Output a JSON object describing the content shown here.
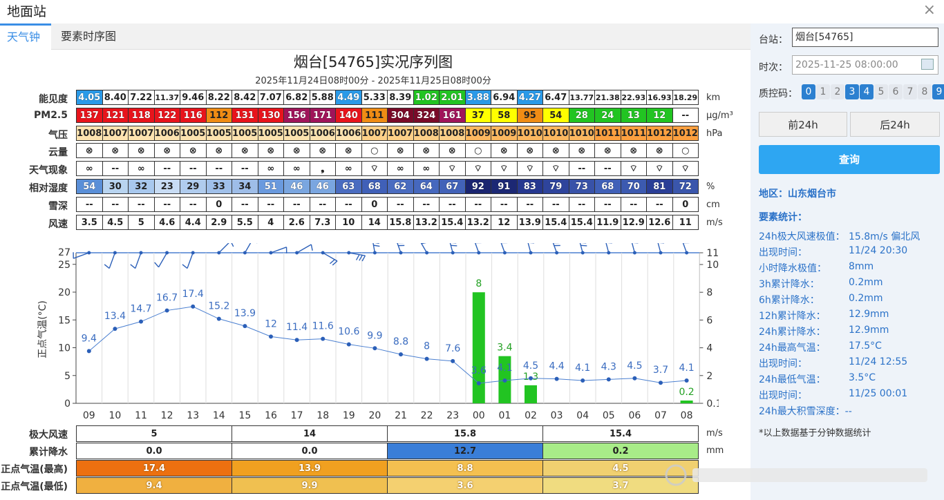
{
  "window": {
    "title": "地面站",
    "close": "×"
  },
  "tabs": [
    "天气钟",
    "要素时序图"
  ],
  "chart_title": "烟台[54765]实况序列图",
  "chart_subtitle": "2025年11月24日08时00分 - 2025年11月25日08时00分",
  "rows": [
    {
      "label": "能见度",
      "unit": "km",
      "values": [
        "4.05",
        "8.40",
        "7.22",
        "11.37",
        "9.46",
        "8.22",
        "8.42",
        "7.07",
        "6.82",
        "5.88",
        "4.49",
        "5.33",
        "8.39",
        "1.02",
        "2.01",
        "3.88",
        "6.94",
        "4.27",
        "6.47",
        "13.77",
        "21.38",
        "22.93",
        "16.93",
        "18.29"
      ],
      "colors": [
        "#2a9ae8",
        "#fff",
        "#fff",
        "#fff",
        "#fff",
        "#fff",
        "#fff",
        "#fff",
        "#fff",
        "#fff",
        "#2a9ae8",
        "#fff",
        "#fff",
        "#22c422",
        "#22c422",
        "#2a9ae8",
        "#fff",
        "#2a9ae8",
        "#fff",
        "#fff",
        "#fff",
        "#fff",
        "#fff",
        "#fff"
      ]
    },
    {
      "label": "PM2.5",
      "unit": "μg/m³",
      "values": [
        "137",
        "121",
        "118",
        "122",
        "116",
        "112",
        "131",
        "130",
        "156",
        "171",
        "140",
        "111",
        "304",
        "324",
        "161",
        "37",
        "58",
        "95",
        "54",
        "28",
        "24",
        "13",
        "12",
        "--"
      ],
      "colors": [
        "#e8141c",
        "#e8141c",
        "#e8141c",
        "#e8141c",
        "#e8141c",
        "#f08c14",
        "#e8141c",
        "#e8141c",
        "#a0145a",
        "#a0145a",
        "#e8141c",
        "#f08c14",
        "#7a0a28",
        "#7a0a28",
        "#a0145a",
        "#ffff00",
        "#ffff00",
        "#f08c14",
        "#ffff00",
        "#22c422",
        "#22c422",
        "#22c422",
        "#22c422",
        "#fff"
      ]
    },
    {
      "label": "气压",
      "unit": "hPa",
      "values": [
        "1008",
        "1007",
        "1007",
        "1006",
        "1005",
        "1005",
        "1005",
        "1005",
        "1005",
        "1006",
        "1006",
        "1007",
        "1007",
        "1008",
        "1008",
        "1009",
        "1009",
        "1010",
        "1010",
        "1010",
        "1011",
        "1011",
        "1012",
        "1012"
      ],
      "colors": [
        "#fde3b0",
        "#fde3b0",
        "#fde3b0",
        "#fde3b0",
        "#fde3b0",
        "#fde3b0",
        "#fde3b0",
        "#fde3b0",
        "#fde3b0",
        "#fde3b0",
        "#fde3b0",
        "#fdd088",
        "#fdd088",
        "#fdd088",
        "#fdd088",
        "#fcb860",
        "#fcb860",
        "#fcb860",
        "#fcb860",
        "#fcb860",
        "#fca040",
        "#fca040",
        "#fca040",
        "#fca040"
      ]
    },
    {
      "label": "云量",
      "unit": "",
      "values": [
        "⊗",
        "⊗",
        "⊗",
        "⊗",
        "⊗",
        "⊗",
        "⊗",
        "⊗",
        "⊗",
        "⊗",
        "⊗",
        "○",
        "⊗",
        "⊗",
        "⊗",
        "○",
        "⊗",
        "⊗",
        "⊗",
        "⊗",
        "⊗",
        "⊗",
        "⊗",
        "○"
      ],
      "colors": []
    },
    {
      "label": "天气现象",
      "unit": "",
      "values": [
        "∞",
        "--",
        "∞",
        "--",
        "--",
        "--",
        "--",
        "∞",
        "∞",
        "❟",
        "∞",
        "⌔",
        "∞",
        "∞",
        "⌔",
        "⌔",
        "⌔",
        "⌔",
        "⌔",
        "--",
        "--",
        "⌔",
        "⌔",
        "⌔"
      ],
      "colors": []
    },
    {
      "label": "相对湿度",
      "unit": "%",
      "values": [
        "54",
        "30",
        "32",
        "23",
        "29",
        "33",
        "34",
        "51",
        "46",
        "46",
        "63",
        "68",
        "62",
        "64",
        "67",
        "92",
        "91",
        "83",
        "79",
        "73",
        "68",
        "70",
        "81",
        "72"
      ],
      "colors": [
        "#5a8fd8",
        "#b8d4f0",
        "#a8c8ee",
        "#c8dcf4",
        "#b0ccee",
        "#a0c0ea",
        "#9ebde8",
        "#6a9ade",
        "#7aa6e0",
        "#7aa6e0",
        "#4a6cc0",
        "#4060b8",
        "#4a6cc0",
        "#4668be",
        "#4262b8",
        "#1a2470",
        "#1c2874",
        "#263890",
        "#2e449c",
        "#3852a8",
        "#4060b8",
        "#3c5ab0",
        "#2a3e96",
        "#3a56ac"
      ]
    },
    {
      "label": "雪深",
      "unit": "cm",
      "values": [
        "--",
        "--",
        "--",
        "--",
        "--",
        "0",
        "--",
        "--",
        "--",
        "--",
        "--",
        "0",
        "--",
        "--",
        "--",
        "--",
        "--",
        "--",
        "--",
        "--",
        "--",
        "--",
        "--",
        "0"
      ],
      "colors": []
    },
    {
      "label": "风速",
      "unit": "m/s",
      "values": [
        "3.5",
        "4.5",
        "5",
        "4.6",
        "4.4",
        "2.9",
        "5.5",
        "4",
        "2.6",
        "7.3",
        "10",
        "14",
        "15.8",
        "13.2",
        "15.4",
        "13.2",
        "12",
        "13.9",
        "15.4",
        "15.4",
        "11.9",
        "12.9",
        "12.6",
        "11"
      ],
      "colors": []
    }
  ],
  "chart_data": {
    "type": "line",
    "x": [
      "09",
      "10",
      "11",
      "12",
      "13",
      "14",
      "15",
      "16",
      "17",
      "18",
      "19",
      "20",
      "21",
      "22",
      "23",
      "00",
      "01",
      "02",
      "03",
      "04",
      "05",
      "06",
      "07",
      "08"
    ],
    "series": [
      {
        "name": "正点气温(°C)",
        "values": [
          9.4,
          13.4,
          14.7,
          16.7,
          17.4,
          15.2,
          13.9,
          12,
          11.4,
          11.6,
          10.6,
          9.9,
          8.8,
          8,
          7.6,
          3.6,
          4.1,
          4.5,
          4.4,
          4.1,
          4.3,
          4.5,
          3.7,
          4.1
        ]
      },
      {
        "name": "小时降水量(mm)",
        "type": "bar",
        "values": [
          0,
          0,
          0,
          0,
          0,
          0,
          0,
          0,
          0,
          0,
          0,
          0,
          0,
          0,
          0,
          8,
          3.4,
          1.3,
          0,
          0,
          0,
          0,
          0,
          0.2
        ]
      }
    ],
    "ylabel": "正点气温(°C)",
    "y2label": "小时降水量(mm)",
    "y_ticks": [
      "0",
      "5",
      "10",
      "15",
      "20",
      "25",
      "27"
    ],
    "y2_ticks": [
      "0.1",
      "2",
      "4",
      "6",
      "8",
      "10",
      "11"
    ],
    "ylim": [
      0,
      27
    ],
    "wind_speed": [
      3.5,
      4.5,
      5,
      4.6,
      4.4,
      2.9,
      5.5,
      4,
      2.6,
      7.3,
      10,
      14,
      15.8,
      13.2,
      15.4,
      13.2,
      12,
      13.9,
      15.4,
      15.4,
      11.9,
      12.9,
      12.6,
      11
    ],
    "wind_dir_deg": [
      250,
      200,
      200,
      210,
      200,
      45,
      30,
      70,
      60,
      120,
      100,
      350,
      340,
      330,
      345,
      340,
      340,
      345,
      340,
      345,
      345,
      345,
      345,
      340
    ],
    "colors": {
      "temp": "#4a7fd0",
      "rain": "#22c422",
      "rain_label": "#22a022"
    }
  },
  "summary": {
    "labels": [
      "极大风速",
      "累计降水",
      "正点气温(最高)",
      "正点气温(最低)"
    ],
    "units": [
      "m/s",
      "mm",
      "",
      ""
    ],
    "values": [
      [
        "5",
        "14",
        "15.8",
        "15.4"
      ],
      [
        "0.0",
        "0.0",
        "12.7",
        "0.2"
      ],
      [
        "17.4",
        "13.9",
        "8.8",
        "4.5"
      ],
      [
        "9.4",
        "9.9",
        "3.6",
        "3.7"
      ]
    ],
    "colors": [
      [
        "#fff",
        "#fff",
        "#fff",
        "#fff"
      ],
      [
        "#fff",
        "#fff",
        "#3a7ed8",
        "#a8ec88"
      ],
      [
        "#ec7010",
        "#f0a020",
        "#f4c050",
        "#f0d070"
      ],
      [
        "#f0b040",
        "#f0c050",
        "#f4d070",
        "#f0dc80"
      ]
    ]
  },
  "sidebar": {
    "station_label": "台站：",
    "station_value": "烟台[54765]",
    "time_label": "时次：",
    "time_value": "2025-11-25 08:00:00",
    "qc_label": "质控码：",
    "qc_codes": [
      "0",
      "1",
      "2",
      "3",
      "4",
      "5",
      "6",
      "7",
      "8",
      "9"
    ],
    "qc_on": [
      true,
      false,
      false,
      true,
      true,
      false,
      false,
      false,
      false,
      true
    ],
    "prev_btn": "前24h",
    "next_btn": "后24h",
    "query_btn": "查询",
    "region": "地区：山东烟台市",
    "stats_title": "要素统计：",
    "stats": [
      {
        "k": "24h极大风速极值：",
        "v": "15.8m/s 偏北风"
      },
      {
        "k": "出现时间：",
        "v": "11/24 20:30"
      },
      {
        "k": "小时降水极值：",
        "v": "8mm"
      },
      {
        "k": "3h累计降水：",
        "v": "0.2mm"
      },
      {
        "k": "6h累计降水：",
        "v": "0.2mm"
      },
      {
        "k": "12h累计降水：",
        "v": "12.9mm"
      },
      {
        "k": "24h累计降水：",
        "v": "12.9mm"
      },
      {
        "k": "24h最高气温：",
        "v": "17.5°C"
      },
      {
        "k": "出现时间：",
        "v": "11/24 12:55"
      },
      {
        "k": "24h最低气温：",
        "v": "3.5°C"
      },
      {
        "k": "出现时间：",
        "v": "11/25 00:01"
      },
      {
        "k": "24h最大积雪深度：--",
        "v": ""
      }
    ],
    "note": "*以上数据基于分钟数据统计"
  }
}
